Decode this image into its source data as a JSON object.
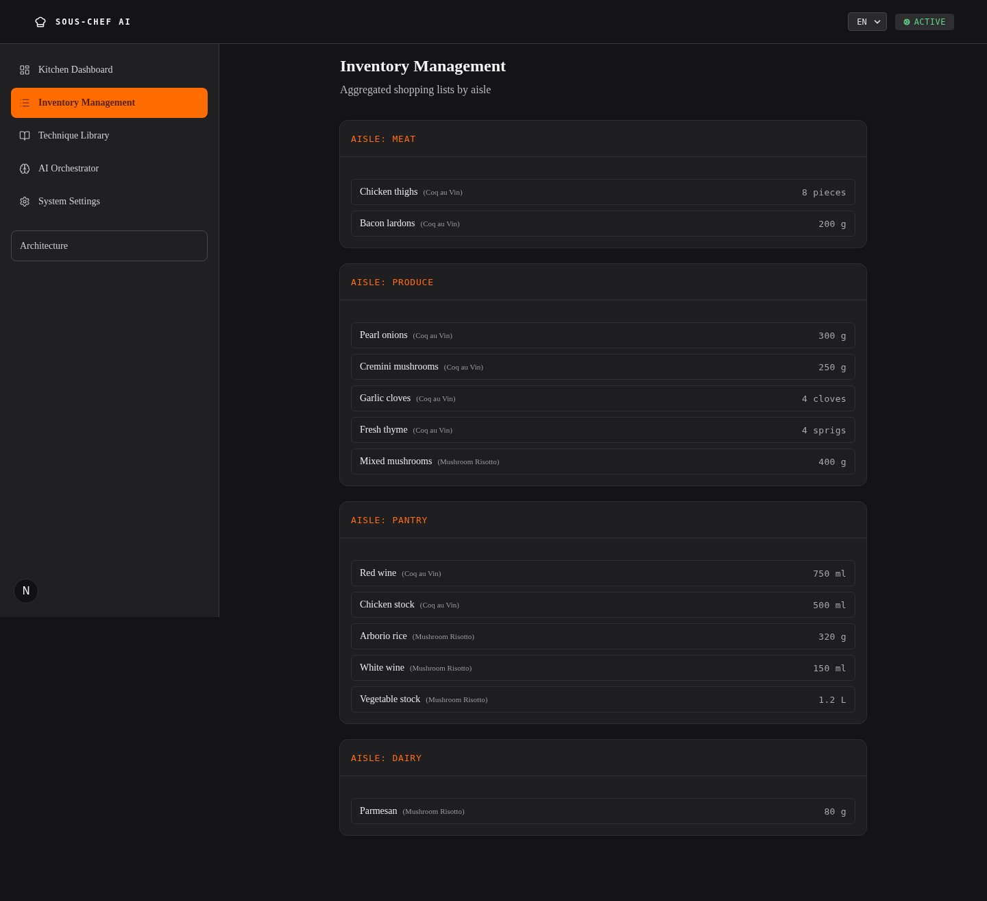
{
  "header": {
    "logo": "SOUS-CHEF AI",
    "language": {
      "value": "EN"
    },
    "status": {
      "label": "ACTIVE"
    }
  },
  "sidebar": {
    "items": [
      {
        "label": "Kitchen Dashboard",
        "kind": "dashboard",
        "selected": false
      },
      {
        "label": "Inventory Management",
        "kind": "list",
        "selected": true
      },
      {
        "label": "Technique Library",
        "kind": "book",
        "selected": false
      },
      {
        "label": "AI Orchestrator",
        "kind": "brain",
        "selected": false
      },
      {
        "label": "System Settings",
        "kind": "settings",
        "selected": false
      }
    ],
    "architecture_button": "Architecture",
    "dev_indicator": "N"
  },
  "page": {
    "title": "Inventory Management",
    "subtitle": "Aggregated shopping lists by aisle"
  },
  "aisles": [
    {
      "title": "AISLE: MEAT",
      "items": [
        {
          "name": "Chicken thighs",
          "recipe": "(Coq au Vin)",
          "amount": "8 pieces"
        },
        {
          "name": "Bacon lardons",
          "recipe": "(Coq au Vin)",
          "amount": "200 g"
        }
      ]
    },
    {
      "title": "AISLE: PRODUCE",
      "items": [
        {
          "name": "Pearl onions",
          "recipe": "(Coq au Vin)",
          "amount": "300 g"
        },
        {
          "name": "Cremini mushrooms",
          "recipe": "(Coq au Vin)",
          "amount": "250 g"
        },
        {
          "name": "Garlic cloves",
          "recipe": "(Coq au Vin)",
          "amount": "4 cloves"
        },
        {
          "name": "Fresh thyme",
          "recipe": "(Coq au Vin)",
          "amount": "4 sprigs"
        },
        {
          "name": "Mixed mushrooms",
          "recipe": "(Mushroom Risotto)",
          "amount": "400 g"
        }
      ]
    },
    {
      "title": "AISLE: PANTRY",
      "items": [
        {
          "name": "Red wine",
          "recipe": "(Coq au Vin)",
          "amount": "750 ml"
        },
        {
          "name": "Chicken stock",
          "recipe": "(Coq au Vin)",
          "amount": "500 ml"
        },
        {
          "name": "Arborio rice",
          "recipe": "(Mushroom Risotto)",
          "amount": "320 g"
        },
        {
          "name": "White wine",
          "recipe": "(Mushroom Risotto)",
          "amount": "150 ml"
        },
        {
          "name": "Vegetable stock",
          "recipe": "(Mushroom Risotto)",
          "amount": "1.2 L"
        }
      ]
    },
    {
      "title": "AISLE: DAIRY",
      "items": [
        {
          "name": "Parmesan",
          "recipe": "(Mushroom Risotto)",
          "amount": "80 g"
        }
      ]
    }
  ]
}
